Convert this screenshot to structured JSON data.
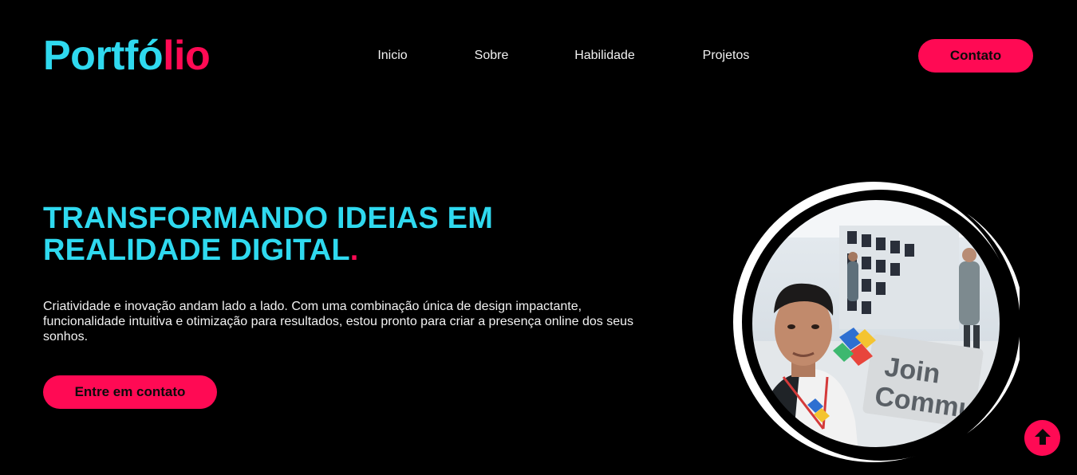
{
  "header": {
    "logo_part1": "Portfó",
    "logo_part2": "lio",
    "nav": [
      "Inicio",
      "Sobre",
      "Habilidade",
      "Projetos"
    ],
    "contact_label": "Contato"
  },
  "hero": {
    "title_line1": "TRANSFORMANDO IDEIAS EM",
    "title_line2": "REALIDADE DIGITAL",
    "title_dot": ".",
    "paragraph": "Criatividade e inovação andam lado a lado. Com uma combinação única de design impactante, funcionalidade intuitiva e otimização para resultados, estou pronto para criar a presença online dos seus sonhos.",
    "cta_label": "Entre em contato"
  },
  "avatar": {
    "sign_text_line1": "Join",
    "sign_text_line2": "Commu"
  },
  "icons": {
    "back_to_top": "arrow-up-icon"
  },
  "colors": {
    "background": "#000000",
    "primary_cyan": "#2fd9ef",
    "accent_pink": "#ff0a54",
    "text": "#f2f2f2"
  }
}
